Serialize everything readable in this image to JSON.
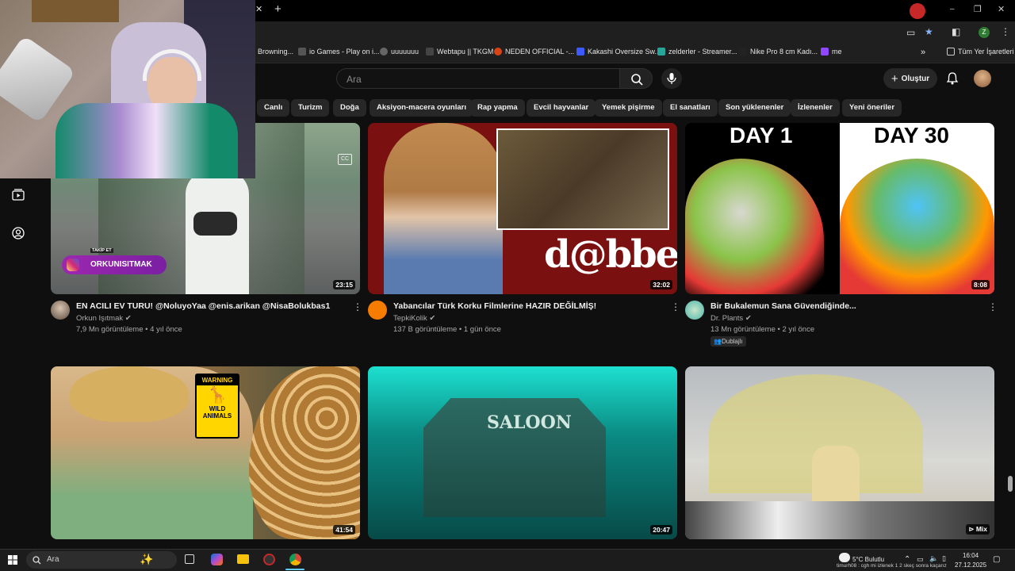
{
  "browser": {
    "bookmarks": [
      {
        "label": "Browning..."
      },
      {
        "label": "io Games - Play on i..."
      },
      {
        "label": "uuuuuuu"
      },
      {
        "label": "Webtapu || TKGM"
      },
      {
        "label": "NEDEN OFFICIAL -..."
      },
      {
        "label": "Kakashi Oversize Sw..."
      },
      {
        "label": "zelderler - Streamer..."
      },
      {
        "label": "Nike Pro 8 cm Kadı..."
      },
      {
        "label": "me"
      }
    ],
    "all_bookmarks": "Tüm Yer İşaretleri",
    "profile_initial": "Z"
  },
  "youtube": {
    "search_placeholder": "Ara",
    "create_label": "Oluştur",
    "chips": [
      "Canlı",
      "Turizm",
      "Doğa",
      "Aksiyon-macera oyunları",
      "Rap yapma",
      "Evcil hayvanlar",
      "Yemek pişirme",
      "El sanatları",
      "Son yüklenenler",
      "İzlenenler",
      "Yeni öneriler"
    ],
    "videos": [
      {
        "title": "EN ACILI EV TURU! @NoluyoYaa @enis.arikan @NisaBolukbas1",
        "channel": "Orkun Işıtmak",
        "meta": "7,9 Mn görüntüleme • 4 yıl önce",
        "duration": "23:15",
        "overlay_badge": "ORKUNISITMAK",
        "overlay_small": "TAKİP ET"
      },
      {
        "title": "Yabancılar Türk Korku Filmlerine HAZIR DEĞİLMİŞ!",
        "channel": "TepkiKolik",
        "meta": "137 B görüntüleme • 1 gün önce",
        "duration": "32:02",
        "thumb_text": "d@bbe"
      },
      {
        "title": "Bir Bukalemun Sana Güvendiğinde...",
        "channel": "Dr. Plants",
        "meta": "13 Mn görüntüleme • 2 yıl önce",
        "duration": "8:08",
        "badge": "Dublajlı",
        "thumb_left": "DAY 1",
        "thumb_right": "DAY 30"
      },
      {
        "duration": "41:54",
        "sign_top": "WARNING",
        "sign_bottom": "WILD ANIMALS"
      },
      {
        "duration": "20:47",
        "sign": "SALOON"
      },
      {
        "duration": "Mix"
      }
    ]
  },
  "taskbar": {
    "search_placeholder": "Ara",
    "weather": "5°C  Bulutlu",
    "time": "16:04",
    "date": "27.12.2025",
    "ticker": "timurh08 : cgh mi izlenek 1 2 skeç sonra kaçarız"
  }
}
